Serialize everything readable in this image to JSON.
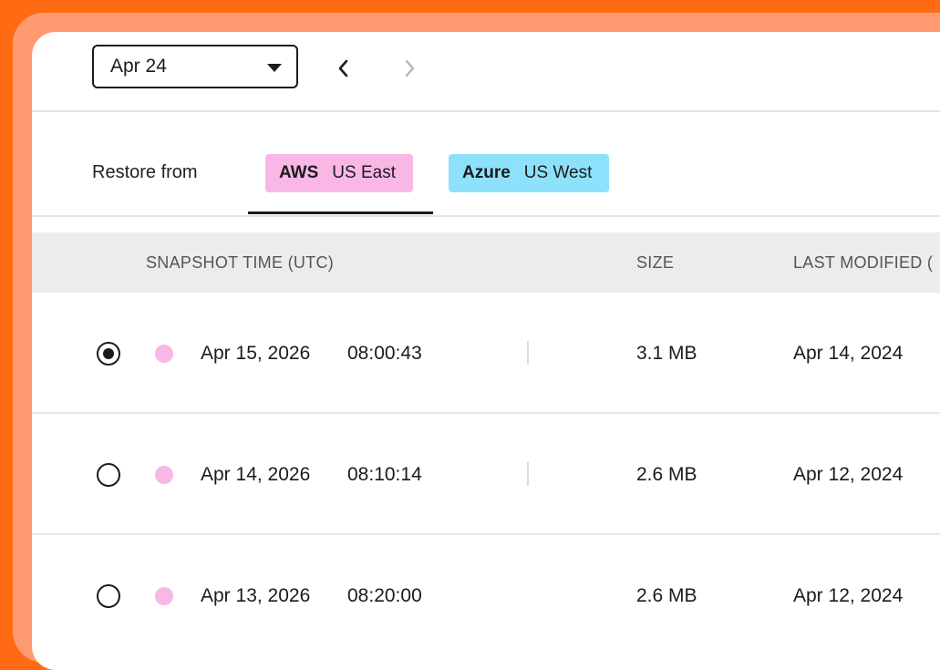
{
  "toolbar": {
    "date_value": "Apr 24",
    "icons": [
      "chevron-down-icon",
      "chevron-left-icon",
      "chevron-right-icon"
    ]
  },
  "restore": {
    "label": "Restore from",
    "sources": [
      {
        "provider": "AWS",
        "region": "US East",
        "color": "#f9b7e6",
        "selected": true
      },
      {
        "provider": "Azure",
        "region": "US West",
        "color": "#8ee1fb",
        "selected": false
      }
    ]
  },
  "table": {
    "headers": [
      "SNAPSHOT TIME (UTC)",
      "SIZE",
      "LAST MODIFIED ("
    ],
    "rows": [
      {
        "date": "Apr 15, 2026",
        "time": "08:00:43",
        "size": "3.1 MB",
        "modified": "Apr 14, 2024",
        "selected": true
      },
      {
        "date": "Apr 14, 2026",
        "time": "08:10:14",
        "size": "2.6 MB",
        "modified": "Apr 12, 2024",
        "selected": false
      },
      {
        "date": "Apr 13, 2026",
        "time": "08:20:00",
        "size": "2.6 MB",
        "modified": "Apr 12, 2024",
        "selected": false
      }
    ]
  },
  "colors": {
    "frame": "#ff6a13",
    "frame_inner": "#ff9a70",
    "aws_dot": "#f9b7e6",
    "azure_chip": "#8ee1fb"
  }
}
